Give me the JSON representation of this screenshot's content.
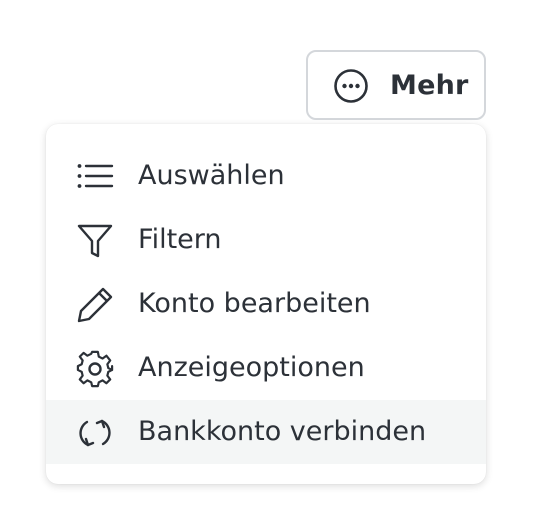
{
  "toolbar": {
    "more_button": {
      "label": "Mehr",
      "icon": "more-horizontal-circle-icon"
    }
  },
  "menu": {
    "items": [
      {
        "label": "Auswählen",
        "icon": "list-icon"
      },
      {
        "label": "Filtern",
        "icon": "filter-icon"
      },
      {
        "label": "Konto bearbeiten",
        "icon": "pencil-icon"
      },
      {
        "label": "Anzeigeoptionen",
        "icon": "gear-icon"
      },
      {
        "label": "Bankkonto verbinden",
        "icon": "sync-icon",
        "highlighted": true
      }
    ]
  },
  "colors": {
    "text": "#2c3138",
    "border": "#d4d7db",
    "highlight": "#f4f6f6"
  }
}
